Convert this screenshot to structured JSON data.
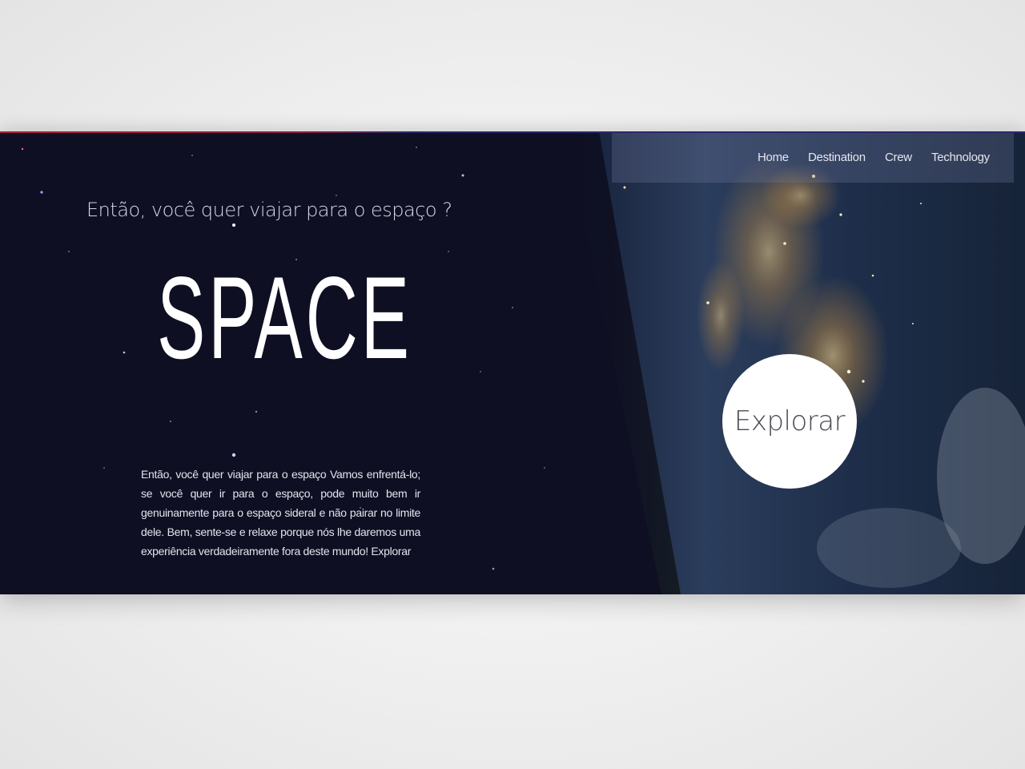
{
  "nav": {
    "items": [
      {
        "label": "Home"
      },
      {
        "label": "Destination"
      },
      {
        "label": "Crew"
      },
      {
        "label": "Technology"
      }
    ]
  },
  "hero": {
    "subtitle": "Então, você quer viajar para o espaço ?",
    "title": "SPACE",
    "description": "Então, você quer viajar para o espaço Vamos enfrentá-lo; se você quer ir para o espaço, pode muito bem ir genuinamente para o espaço sideral e não pairar no limite dele. Bem, sente-se e relaxe porque nós lhe daremos uma experiência verdadeiramente fora deste mundo! Explorar",
    "explore_button": "Explorar"
  },
  "colors": {
    "space_background": "#0e0f23",
    "text_light": "#e2e4ec",
    "button_background": "#ffffff",
    "button_text": "#4a4c54",
    "accent_line": "#b0203a"
  }
}
